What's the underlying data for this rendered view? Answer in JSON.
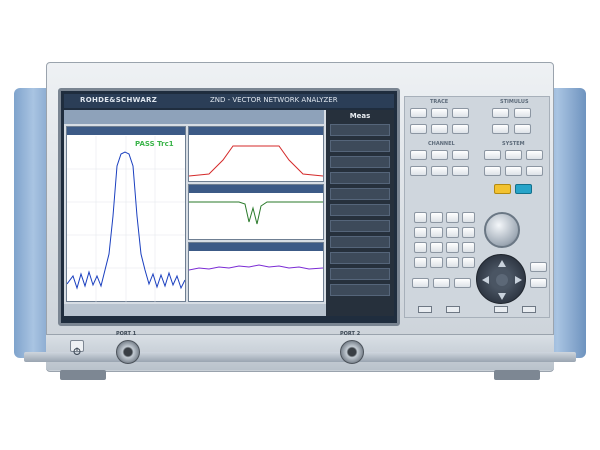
{
  "instrument": {
    "brand": "ROHDE&SCHWARZ",
    "model": "ZND - VECTOR NETWORK ANALYZER"
  },
  "screen": {
    "limit_text": "PASS Trc1",
    "softkey_menu_title": "Meas",
    "traces": [
      {
        "color": "#1a3fbf"
      },
      {
        "color": "#d42a2a"
      },
      {
        "color": "#2a7a2a"
      },
      {
        "color": "#7a2ad4"
      }
    ]
  },
  "panel": {
    "sections": [
      "TRACE",
      "STIMULUS",
      "CHANNEL",
      "SYSTEM"
    ],
    "accent_keys": {
      "yellow": "#f2c230",
      "cyan": "#27a4c9"
    }
  },
  "ports": [
    "PORT 1",
    "PORT 2"
  ]
}
